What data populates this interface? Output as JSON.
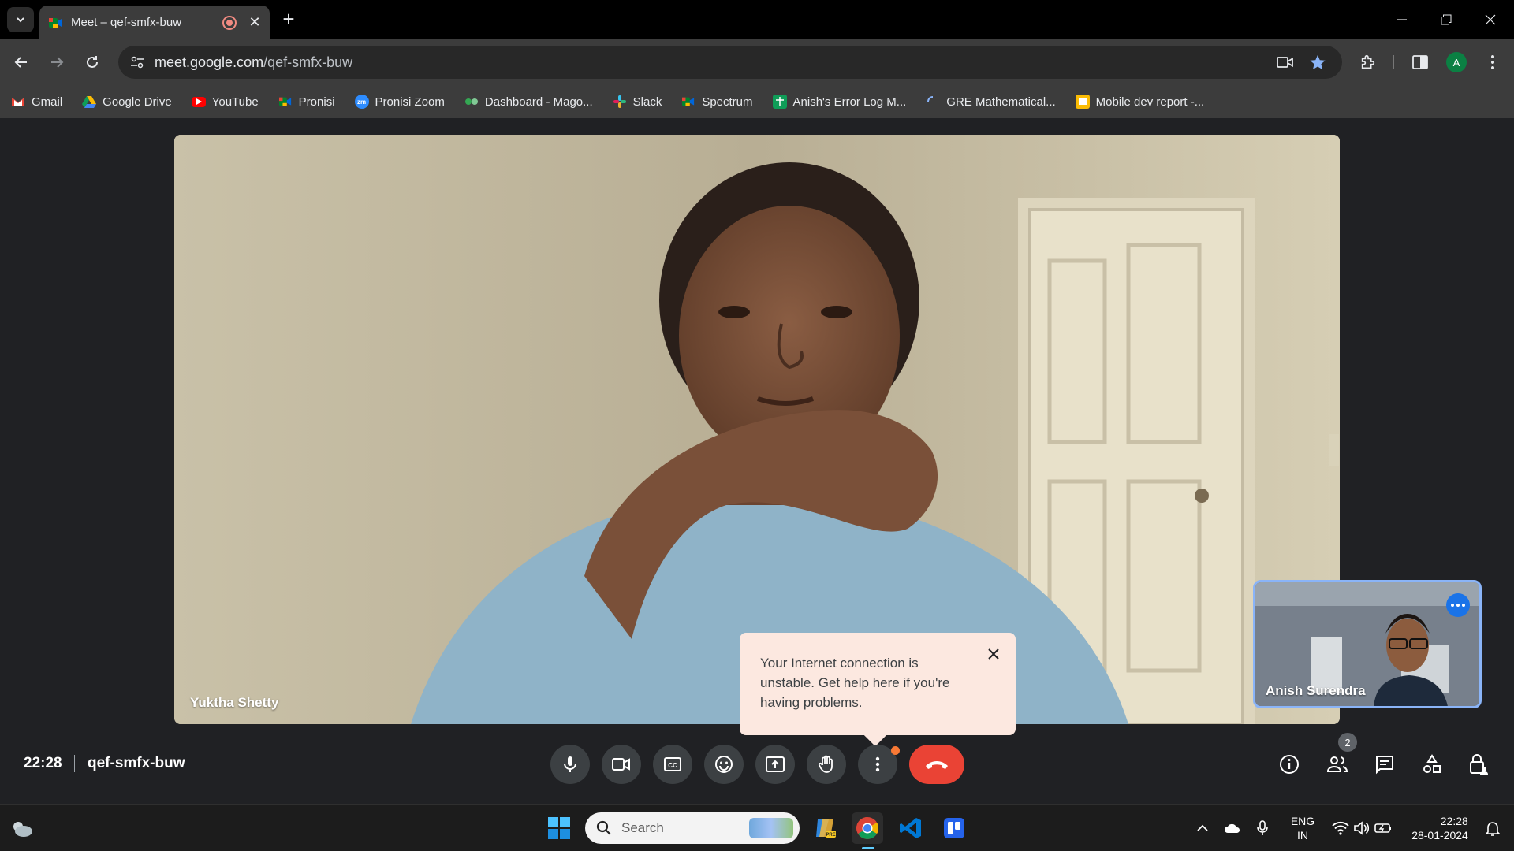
{
  "browser": {
    "tab": {
      "title": "Meet – qef-smfx-buw"
    },
    "url": {
      "host": "meet.google.com",
      "path": "/qef-smfx-buw"
    },
    "profile_initial": "A",
    "bookmarks": [
      {
        "label": "Gmail",
        "icon": "gmail-icon",
        "color": "#ea4335"
      },
      {
        "label": "Google Drive",
        "icon": "drive-icon",
        "color": "#fbbc04"
      },
      {
        "label": "YouTube",
        "icon": "youtube-icon",
        "color": "#ff0000"
      },
      {
        "label": "Pronisi",
        "icon": "meet-icon",
        "color": "#00832d"
      },
      {
        "label": "Pronisi Zoom",
        "icon": "zoom-icon",
        "color": "#2d8cff"
      },
      {
        "label": "Dashboard - Mago...",
        "icon": "dashboard-icon",
        "color": "#34a853"
      },
      {
        "label": "Slack",
        "icon": "slack-icon",
        "color": "#e01e5a"
      },
      {
        "label": "Spectrum",
        "icon": "meet-icon",
        "color": "#00832d"
      },
      {
        "label": "Anish's Error Log M...",
        "icon": "sheets-icon",
        "color": "#0f9d58"
      },
      {
        "label": "GRE Mathematical...",
        "icon": "loading-icon",
        "color": "#8ab4f8"
      },
      {
        "label": "Mobile dev report -...",
        "icon": "slides-icon",
        "color": "#fbbc04"
      }
    ]
  },
  "meet": {
    "main_participant": "Yuktha Shetty",
    "self_participant": "Anish Surendra",
    "time": "22:28",
    "meeting_code": "qef-smfx-buw",
    "people_count": "2",
    "toast": "Your Internet connection is unstable. Get help here if you're having problems."
  },
  "taskbar": {
    "search_label": "Search",
    "lang_1": "ENG",
    "lang_2": "IN",
    "clock_time": "22:28",
    "clock_date": "28-01-2024"
  }
}
